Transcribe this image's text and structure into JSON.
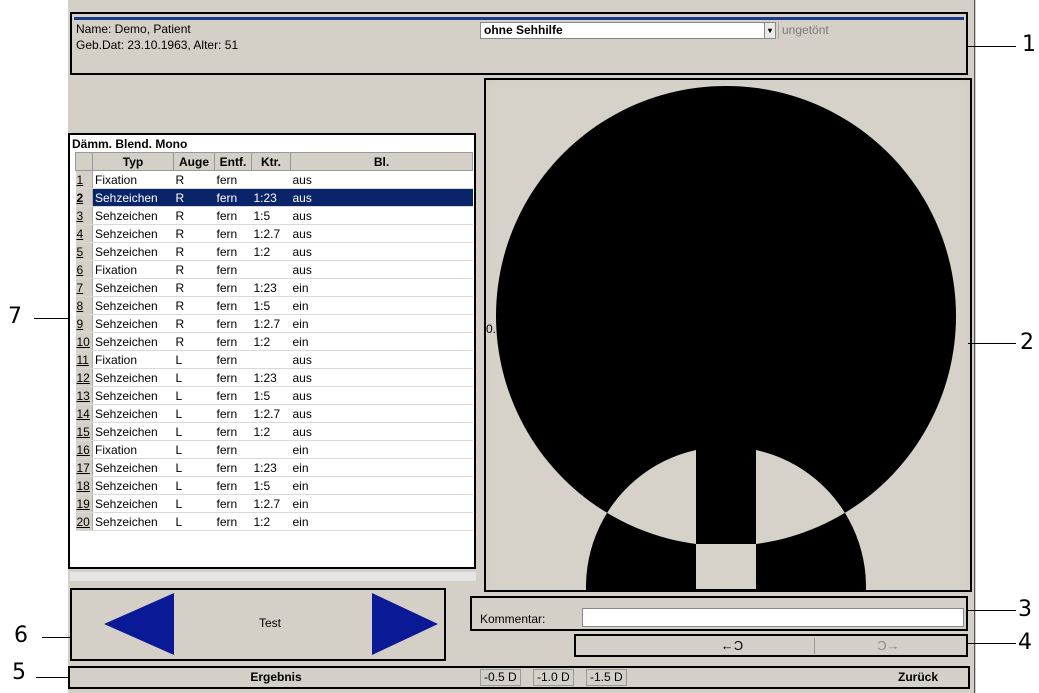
{
  "header": {
    "patient_name": "Name: Demo, Patient",
    "patient_dob": "Geb.Dat: 23.10.1963, Alter: 51",
    "visual_aid": "ohne Sehhilfe",
    "tint": "ungetönt"
  },
  "table": {
    "title": "Dämm. Blend. Mono",
    "columns": [
      "",
      "Typ",
      "Auge",
      "Entf.",
      "Ktr.",
      "Bl."
    ],
    "selected_index": 1,
    "rows": [
      {
        "n": "1",
        "typ": "Fixation",
        "auge": "R",
        "entf": "fern",
        "ktr": "",
        "bl": "aus"
      },
      {
        "n": "2",
        "typ": "Sehzeichen",
        "auge": "R",
        "entf": "fern",
        "ktr": "1:23",
        "bl": "aus"
      },
      {
        "n": "3",
        "typ": "Sehzeichen",
        "auge": "R",
        "entf": "fern",
        "ktr": "1:5",
        "bl": "aus"
      },
      {
        "n": "4",
        "typ": "Sehzeichen",
        "auge": "R",
        "entf": "fern",
        "ktr": "1:2.7",
        "bl": "aus"
      },
      {
        "n": "5",
        "typ": "Sehzeichen",
        "auge": "R",
        "entf": "fern",
        "ktr": "1:2",
        "bl": "aus"
      },
      {
        "n": "6",
        "typ": "Fixation",
        "auge": "R",
        "entf": "fern",
        "ktr": "",
        "bl": "aus"
      },
      {
        "n": "7",
        "typ": "Sehzeichen",
        "auge": "R",
        "entf": "fern",
        "ktr": "1:23",
        "bl": "ein"
      },
      {
        "n": "8",
        "typ": "Sehzeichen",
        "auge": "R",
        "entf": "fern",
        "ktr": "1:5",
        "bl": "ein"
      },
      {
        "n": "9",
        "typ": "Sehzeichen",
        "auge": "R",
        "entf": "fern",
        "ktr": "1:2.7",
        "bl": "ein"
      },
      {
        "n": "10",
        "typ": "Sehzeichen",
        "auge": "R",
        "entf": "fern",
        "ktr": "1:2",
        "bl": "ein"
      },
      {
        "n": "11",
        "typ": "Fixation",
        "auge": "L",
        "entf": "fern",
        "ktr": "",
        "bl": "aus"
      },
      {
        "n": "12",
        "typ": "Sehzeichen",
        "auge": "L",
        "entf": "fern",
        "ktr": "1:23",
        "bl": "aus"
      },
      {
        "n": "13",
        "typ": "Sehzeichen",
        "auge": "L",
        "entf": "fern",
        "ktr": "1:5",
        "bl": "aus"
      },
      {
        "n": "14",
        "typ": "Sehzeichen",
        "auge": "L",
        "entf": "fern",
        "ktr": "1:2.7",
        "bl": "aus"
      },
      {
        "n": "15",
        "typ": "Sehzeichen",
        "auge": "L",
        "entf": "fern",
        "ktr": "1:2",
        "bl": "aus"
      },
      {
        "n": "16",
        "typ": "Fixation",
        "auge": "L",
        "entf": "fern",
        "ktr": "",
        "bl": "ein"
      },
      {
        "n": "17",
        "typ": "Sehzeichen",
        "auge": "L",
        "entf": "fern",
        "ktr": "1:23",
        "bl": "ein"
      },
      {
        "n": "18",
        "typ": "Sehzeichen",
        "auge": "L",
        "entf": "fern",
        "ktr": "1:5",
        "bl": "ein"
      },
      {
        "n": "19",
        "typ": "Sehzeichen",
        "auge": "L",
        "entf": "fern",
        "ktr": "1:2.7",
        "bl": "ein"
      },
      {
        "n": "20",
        "typ": "Sehzeichen",
        "auge": "L",
        "entf": "fern",
        "ktr": "1:2",
        "bl": "ein"
      }
    ]
  },
  "stimulus": {
    "acuity_label": "0.10",
    "icon": "landolt-ring-icon"
  },
  "comment": {
    "label": "Kommentar:",
    "value": ""
  },
  "history": {
    "undo_label": "←Ɔ",
    "redo_label": "Ɔ→"
  },
  "nav": {
    "test_label": "Test",
    "prev_icon": "left-triangle-icon",
    "next_icon": "right-triangle-icon"
  },
  "bottom": {
    "result_label": "Ergebnis",
    "diopters": [
      "-0.5 D",
      "-1.0 D",
      "-1.5 D"
    ],
    "back_label": "Zurück"
  },
  "callouts": [
    "1",
    "2",
    "3",
    "4",
    "5",
    "6",
    "7"
  ],
  "colors": {
    "panel": "#d4d0c8",
    "selection": "#0a246a",
    "nav_arrow": "#0a1a96",
    "header_line": "#1a3b8c"
  }
}
